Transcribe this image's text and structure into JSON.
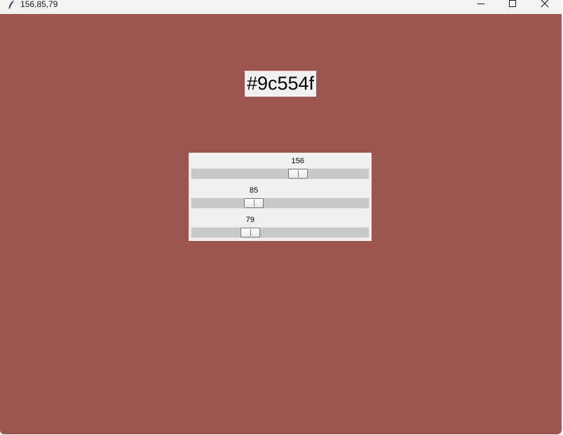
{
  "window": {
    "title": "156,85,79",
    "background_color": "#9c554f",
    "controls": {
      "minimize": "minimize-icon",
      "maximize": "maximize-icon",
      "close": "close-icon"
    },
    "app_icon": "feather-icon"
  },
  "color_label": {
    "text": "#9c554f"
  },
  "sliders": [
    {
      "channel": "red",
      "value": 156,
      "value_text": "156",
      "min": 0,
      "max": 255
    },
    {
      "channel": "green",
      "value": 85,
      "value_text": "85",
      "min": 0,
      "max": 255
    },
    {
      "channel": "blue",
      "value": 79,
      "value_text": "79",
      "min": 0,
      "max": 255
    }
  ]
}
